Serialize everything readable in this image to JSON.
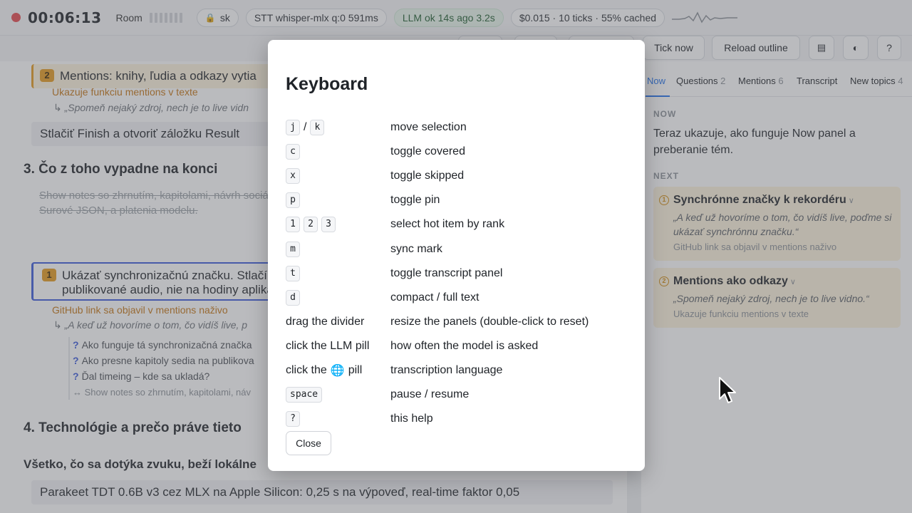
{
  "topbar": {
    "timer": "00:06:13",
    "room_label": "Room",
    "user_pill": "sk",
    "stt_pill": "STT whisper-mlx q:0 591ms",
    "llm_pill": "LLM ok 14s ago 3.2s",
    "cost_pill": "$0.015 · 10 ticks · 55% cached"
  },
  "toolbar": {
    "tick_now": "Tick now",
    "reload_outline": "Reload outline",
    "layout_icon": "▤",
    "theme_icon": "◐",
    "help": "?"
  },
  "outline": {
    "item_mentions": {
      "rank": "2",
      "text": "Mentions: knihy, ľudia a odkazy vytia",
      "hint": "Ukazuje funkciu mentions v texte",
      "quote": "↳ „Spomeň nejaký zdroj, nech je to live vidn"
    },
    "item_finish": "Stlačiť Finish a otvoriť záložku Result",
    "heading_3": "3. Čo z toho vypadne na konci",
    "strike_text": "Show notes so zhrnutím, kapitolami, návrh sociálne siete. Pôvodná osnova, znak po z ako Markdown a ako SRT. Surové JSON, a platenia modelu.",
    "item_sync": {
      "rank": "1",
      "text_line1": "Ukázať synchronizačnú značku. Stlačí",
      "text_line2": "publikované audio, nie na hodiny aplika",
      "hint": "GitHub link sa objavil v mentions naživo",
      "quote": "↳ „A keď už hovoríme o tom, čo vidíš live, p"
    },
    "questions": [
      "Ako funguje tá synchronizačná značka",
      "Ako presne kapitoly sedia na publikova",
      "Ďal timeing – kde sa ukladá?"
    ],
    "related": "↔ Show notes so zhrnutím, kapitolami, náv",
    "heading_4": "4. Technológie a prečo práve tieto",
    "bold_line": "Všetko, čo sa dotýka zvuku, beží lokálne",
    "item_parakeet": "Parakeet TDT 0.6B v3 cez MLX na Apple Silicon: 0,25 s na výpoveď, real-time faktor 0,05"
  },
  "right_panel": {
    "tabs": [
      {
        "label": "Now",
        "count": ""
      },
      {
        "label": "Questions",
        "count": "2"
      },
      {
        "label": "Mentions",
        "count": "6"
      },
      {
        "label": "Transcript",
        "count": ""
      },
      {
        "label": "New topics",
        "count": "4"
      }
    ],
    "now_label": "NOW",
    "now_text": "Teraz ukazuje, ako funguje Now panel a preberanie tém.",
    "next_label": "NEXT",
    "next_items": [
      {
        "num": "1",
        "title": "Synchrónne značky k rekordéru",
        "quote": "„A keď už hovoríme o tom, čo vidíš live, poďme si ukázať synchrónnu značku.“",
        "note": "GitHub link sa objavil v mentions naživo"
      },
      {
        "num": "2",
        "title": "Mentions ako odkazy",
        "quote": "„Spomeň nejaký zdroj, nech je to live vidno.“",
        "note": "Ukazuje funkciu mentions v texte"
      }
    ]
  },
  "modal": {
    "title": "Keyboard",
    "close_label": "Close",
    "rows": [
      {
        "keys_kbd": [
          "j",
          "k"
        ],
        "sep": "/",
        "desc": "move selection"
      },
      {
        "keys_kbd": [
          "c"
        ],
        "desc": "toggle covered"
      },
      {
        "keys_kbd": [
          "x"
        ],
        "desc": "toggle skipped"
      },
      {
        "keys_kbd": [
          "p"
        ],
        "desc": "toggle pin"
      },
      {
        "keys_kbd": [
          "1",
          "2",
          "3"
        ],
        "desc": "select hot item by rank"
      },
      {
        "keys_kbd": [
          "m"
        ],
        "desc": "sync mark"
      },
      {
        "keys_kbd": [
          "t"
        ],
        "desc": "toggle transcript panel"
      },
      {
        "keys_kbd": [
          "d"
        ],
        "desc": "compact / full text"
      },
      {
        "keys_text": "drag the divider",
        "desc": "resize the panels (double-click to reset)"
      },
      {
        "keys_text": "click the LLM pill",
        "desc": "how often the model is asked"
      },
      {
        "keys_text_a": "click the",
        "globe": "🌐",
        "keys_text_b": "pill",
        "desc": "transcription language"
      },
      {
        "keys_kbd": [
          "space"
        ],
        "desc": "pause / resume"
      },
      {
        "keys_kbd": [
          "?"
        ],
        "desc": "this help"
      }
    ]
  },
  "colors": {
    "accent": "#1f6feb",
    "rank_badge": "#e59a1c",
    "recording": "#e5484d",
    "next_card_bg": "#fdf3dc"
  }
}
